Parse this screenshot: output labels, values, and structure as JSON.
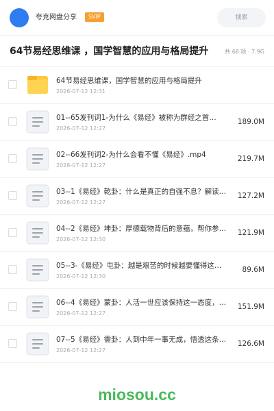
{
  "header": {
    "site_name": "夸克网盘分享",
    "badge": "SVIP",
    "search_label": "搜索",
    "avatar_color": "#2d7cf0",
    "badge_color": "#f7a032"
  },
  "folder": {
    "title": "64节易经思维课 ，国学智慧的应用与格局提升",
    "meta": "共 68 项 · 7.9G"
  },
  "files": [
    {
      "icon": "folder-icon",
      "name": "64节易经思维课，国学智慧的应用与格局提升",
      "date": "2026-07-12 12:31",
      "size": ""
    },
    {
      "icon": "document-icon",
      "name": "01--65发刊词1-为什么《易经》被称为群经之首…",
      "date": "2026-07-12 12:27",
      "size": "189.0M"
    },
    {
      "icon": "document-icon",
      "name": "02--66发刊词2-为什么会看不懂《易经》.mp4",
      "date": "2026-07-12 12:27",
      "size": "219.7M"
    },
    {
      "icon": "document-icon",
      "name": "03--1《易经》乾卦：什么是真正的自强不息？解读…",
      "date": "2026-07-12 12:27",
      "size": "127.2M"
    },
    {
      "icon": "document-icon",
      "name": "04--2《易经》坤卦：厚德载物背后的意蕴，帮你参…",
      "date": "2026-07-12 12:30",
      "size": "121.9M"
    },
    {
      "icon": "document-icon",
      "name": "05--3-《易经》屯卦：越是艰苦的时候越要懂得这…",
      "date": "2026-07-12 12:30",
      "size": "89.6M"
    },
    {
      "icon": "document-icon",
      "name": "06--4《易经》蒙卦：人活一世应该保持这一态度，…",
      "date": "2026-07-12 12:27",
      "size": "151.9M"
    },
    {
      "icon": "document-icon",
      "name": "07--5《易经》需卦：人到中年一事无成，悟透这条…",
      "date": "2026-07-12 12:27",
      "size": "126.6M"
    }
  ],
  "watermark": "miosou.cc",
  "watermark_color": "#49b95a"
}
